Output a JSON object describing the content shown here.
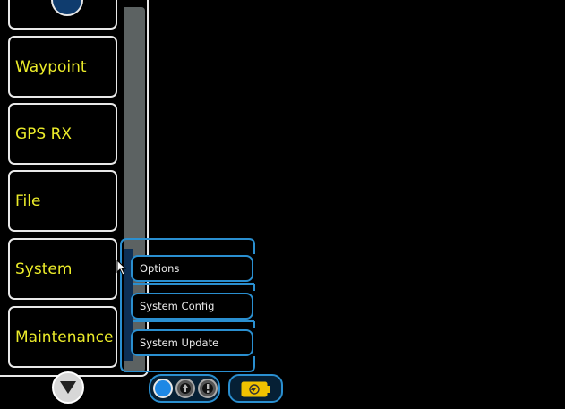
{
  "menu": {
    "items": [
      {
        "label": ""
      },
      {
        "label": "Waypoint"
      },
      {
        "label": "GPS RX"
      },
      {
        "label": "File"
      },
      {
        "label": "System"
      },
      {
        "label": "Maintenance"
      }
    ],
    "scroll_up_icon": "up-arrow-icon",
    "scroll_down_icon": "down-arrow-icon"
  },
  "submenu": {
    "items": [
      {
        "label": "Options"
      },
      {
        "label": "System Config"
      },
      {
        "label": "System Update"
      }
    ]
  },
  "status": {
    "indicators": [
      "status-dot-icon",
      "info-icon",
      "alert-icon"
    ],
    "battery_icon": "battery-charging-icon"
  },
  "colors": {
    "menu_text": "#ecec2a",
    "accent_blue": "#2a8fd0",
    "battery": "#f0c200"
  }
}
